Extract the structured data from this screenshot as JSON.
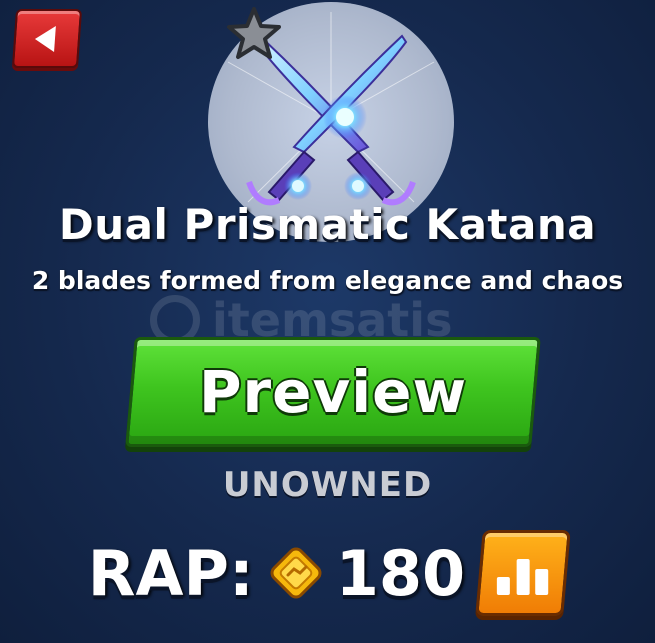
{
  "nav": {
    "back_icon": "back-arrow-icon"
  },
  "item": {
    "name": "Dual Prismatic Katana",
    "description": "2 blades formed from elegance and chaos",
    "favorite_icon": "star-icon",
    "status": "UNOWNED"
  },
  "actions": {
    "preview_label": "Preview"
  },
  "rap": {
    "label": "RAP:",
    "value": "180",
    "currency_icon": "diamond-coin-icon",
    "stats_icon": "bar-chart-icon"
  },
  "watermark": {
    "text": "itemsatis"
  },
  "colors": {
    "background": "#15294e",
    "preview_green": "#3fc51f",
    "back_red": "#d22626",
    "stats_orange": "#f59a0d",
    "status_gray": "#c9ccd3"
  }
}
